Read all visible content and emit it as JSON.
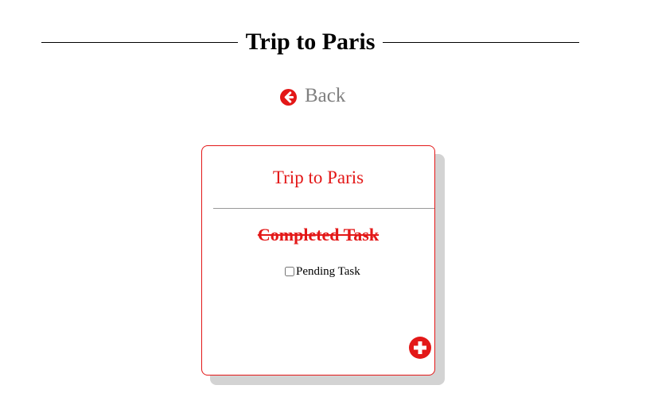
{
  "page": {
    "title": "Trip to Paris"
  },
  "nav": {
    "back_label": "Back",
    "back_icon": "arrow-circle-left-icon"
  },
  "card": {
    "title": "Trip to Paris",
    "tasks": [
      {
        "label": "Completed Task",
        "completed": true
      },
      {
        "label": "Pending Task",
        "completed": false
      }
    ],
    "add_icon": "plus-circle-icon"
  },
  "colors": {
    "accent": "#e31818",
    "muted_text": "#808080",
    "shadow": "#d3d3d3"
  }
}
